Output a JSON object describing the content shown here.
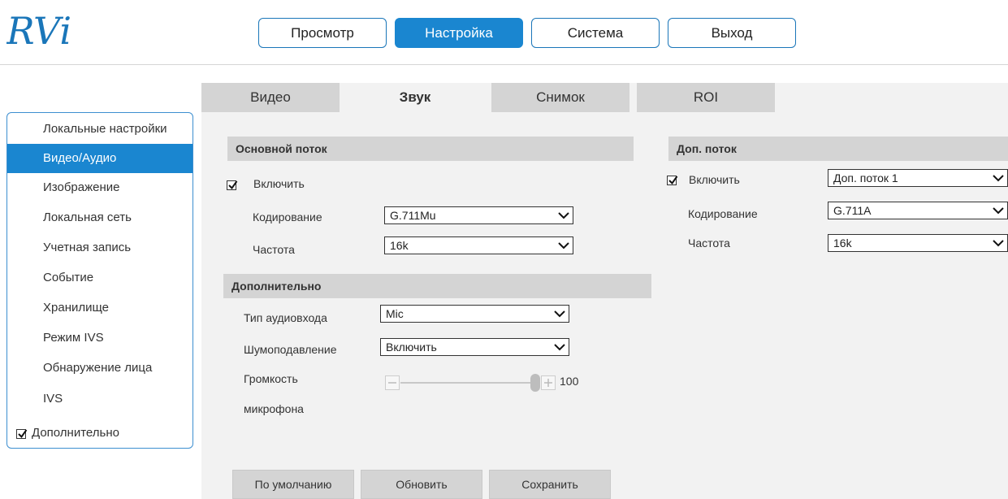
{
  "logo": {
    "text": "RVi"
  },
  "nav": {
    "items": [
      {
        "label": "Просмотр"
      },
      {
        "label": "Настройка"
      },
      {
        "label": "Система"
      },
      {
        "label": "Выход"
      }
    ],
    "active": "Настройка"
  },
  "sidebar": {
    "items": [
      {
        "label": "Локальные настройки"
      },
      {
        "label": "Видео/Аудио"
      },
      {
        "label": "Изображение"
      },
      {
        "label": "Локальная сеть"
      },
      {
        "label": "Учетная запись"
      },
      {
        "label": "Событие"
      },
      {
        "label": "Хранилище"
      },
      {
        "label": "Режим IVS"
      },
      {
        "label": "Обнаружение лица"
      },
      {
        "label": "IVS"
      }
    ],
    "active": "Видео/Аудио",
    "advanced": {
      "label": "Дополнительно",
      "checked": true
    }
  },
  "tabs": {
    "items": [
      {
        "label": "Видео"
      },
      {
        "label": "Звук"
      },
      {
        "label": "Снимок"
      },
      {
        "label": "ROI"
      }
    ],
    "active": "Звук"
  },
  "main_stream": {
    "title": "Основной поток",
    "enable_label": "Включить",
    "enable_checked": true,
    "encoding_label": "Кодирование",
    "encoding_value": "G.711Mu",
    "frequency_label": "Частота",
    "frequency_value": "16k"
  },
  "sub_stream": {
    "title": "Доп. поток",
    "enable_label": "Включить",
    "enable_checked": true,
    "stream_value": "Доп. поток 1",
    "encoding_label": "Кодирование",
    "encoding_value": "G.711A",
    "frequency_label": "Частота",
    "frequency_value": "16k"
  },
  "advanced": {
    "title": "Дополнительно",
    "input_type_label": "Тип аудиовхода",
    "input_type_value": "Mic",
    "noise_label": "Шумоподавление",
    "noise_value": "Включить",
    "volume_label_line1": "Громкость",
    "volume_label_line2": "микрофона",
    "volume_value": "100"
  },
  "buttons": {
    "default_label": "По умолчанию",
    "refresh_label": "Обновить",
    "save_label": "Сохранить"
  },
  "colors": {
    "accent": "#1a86d0",
    "panel": "#f2f2f2",
    "header": "#d4d4d4"
  }
}
